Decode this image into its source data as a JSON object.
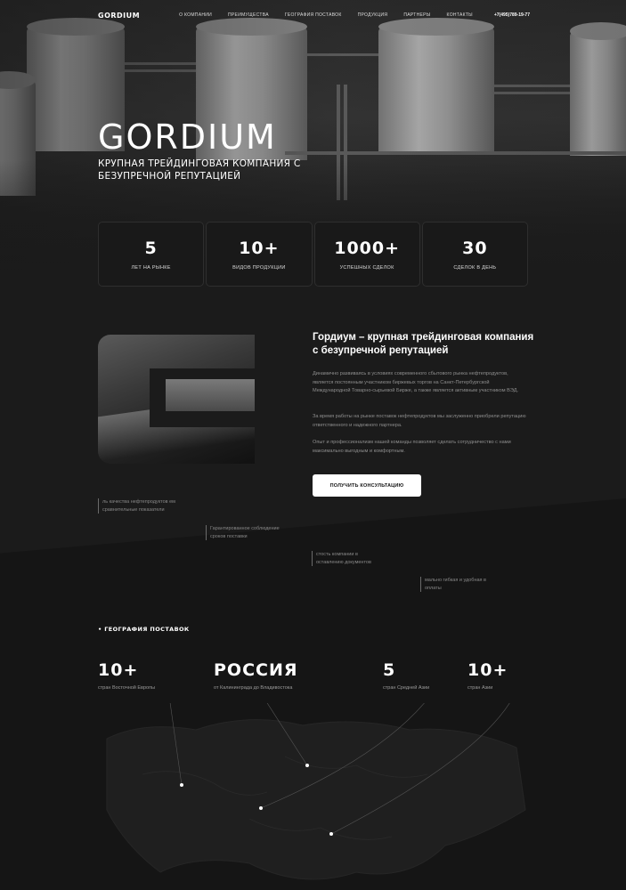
{
  "nav": {
    "logo": "GORDIUM",
    "links": [
      "О компании",
      "Преимущества",
      "География поставок",
      "Продукция",
      "Партнеры",
      "Контакты"
    ],
    "phone": "+7(495)789-19-77"
  },
  "hero": {
    "title": "GORDIUM",
    "subtitle": "Крупная трейдинговая компания с безупречной репутацией"
  },
  "stats": [
    {
      "value": "5",
      "label": "лет на рынке"
    },
    {
      "value": "10+",
      "label": "видов продукции"
    },
    {
      "value": "1000+",
      "label": "успешных сделок"
    },
    {
      "value": "30",
      "label": "сделок в день"
    }
  ],
  "about": {
    "title": "Гордиум – крупная трейдинговая компания с безупречной репутацией",
    "paragraphs": [
      "Динамично развиваясь в условиях современного сбытового рынка нефтепродуктов, является постоянным участником биржевых торгов на Санкт-Петербургской Международной Товарно-сырьевой Бирже, а также является активным участником ВЭД.",
      "За время работы на рынке поставок нефтепродуктов мы заслуженно приобрели репутацию ответственного и надежного партнера.",
      "Опыт и профессионализм нашей команды позволяет сделать сотрудничество с нами максимально выгодным и комфортным."
    ],
    "button": "Получить консультацию"
  },
  "features": [
    "ль качества нефтепродуктов ем сравнительные показатели",
    "Гарантированное соблюдение сроков поставки",
    "стость компании в оставлению документов",
    "мально гибкая и удобная в оплаты"
  ],
  "geography": {
    "heading": "• География поставок",
    "items": [
      {
        "value": "10+",
        "label": "стран Восточной Европы"
      },
      {
        "value": "Россия",
        "label": "от Калининграда до Владивостока"
      },
      {
        "value": "5",
        "label": "стран Средней Азии"
      },
      {
        "value": "10+",
        "label": "стран Азии"
      }
    ]
  },
  "colors": {
    "background": "#1b1b1b",
    "accent": "#ffffff"
  }
}
